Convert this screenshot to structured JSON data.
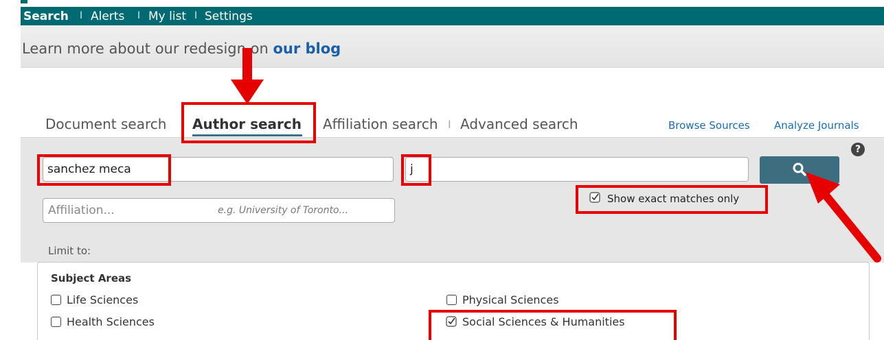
{
  "nav": {
    "items": [
      "Search",
      "Alerts",
      "My list",
      "Settings"
    ],
    "separator": "I"
  },
  "banner": {
    "text": "Learn more about our redesign on ",
    "link": "our blog"
  },
  "tabs": {
    "document": "Document search",
    "author": "Author search",
    "affiliation": "Affiliation search",
    "advanced": "Advanced search",
    "separator": "I"
  },
  "links": {
    "browse_sources": "Browse Sources",
    "analyze_journals": "Analyze Journals"
  },
  "search": {
    "last_name_value": "sanchez meca",
    "first_name_value": "j",
    "affiliation_placeholder": "Affiliation...",
    "affiliation_example": "e.g. University of Toronto...",
    "exact_matches_label": "Show exact matches only",
    "exact_matches_checked": true,
    "help": "?"
  },
  "limit": {
    "label": "Limit to:",
    "heading": "Subject Areas",
    "areas": [
      {
        "label": "Life Sciences",
        "checked": false
      },
      {
        "label": "Health Sciences",
        "checked": false
      },
      {
        "label": "Physical Sciences",
        "checked": false
      },
      {
        "label": "Social Sciences & Humanities",
        "checked": true
      }
    ]
  },
  "colors": {
    "nav_bg": "#006a73",
    "link": "#1a6cb3",
    "search_button": "#3d6e80",
    "annotation": "#e60000"
  }
}
